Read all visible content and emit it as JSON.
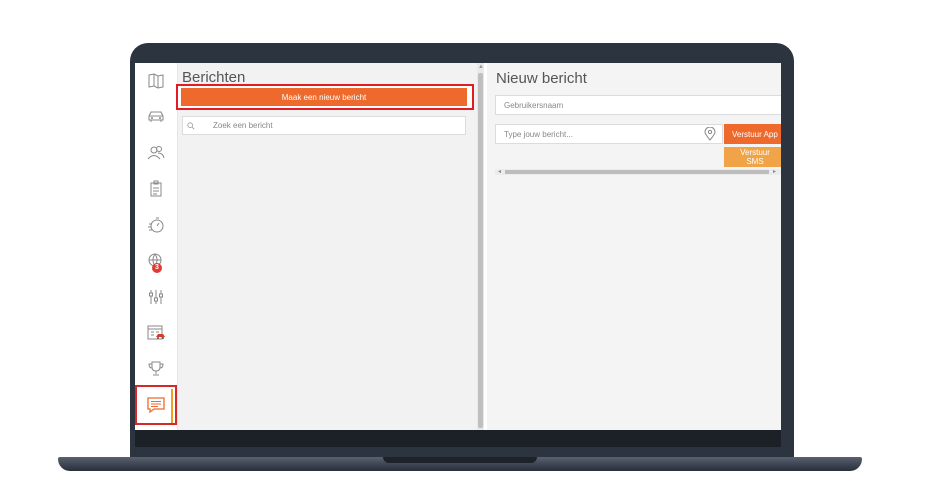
{
  "sidebar": {
    "items": [
      {
        "icon": "map-icon"
      },
      {
        "icon": "car-icon"
      },
      {
        "icon": "users-icon"
      },
      {
        "icon": "clipboard-icon"
      },
      {
        "icon": "stopwatch-icon"
      },
      {
        "icon": "globe-icon",
        "badge": "3"
      },
      {
        "icon": "sliders-icon"
      },
      {
        "icon": "calendar-car-icon"
      },
      {
        "icon": "trophy-icon"
      },
      {
        "icon": "chat-icon",
        "active": true
      }
    ]
  },
  "messages": {
    "title": "Berichten",
    "new_message_label": "Maak een nieuw bericht",
    "search_placeholder": "Zoek een bericht"
  },
  "compose": {
    "title": "Nieuw bericht",
    "recipient_placeholder": "Gebruikersnaam",
    "message_placeholder": "Type jouw bericht...",
    "send_app_label": "Verstuur App",
    "send_sms_label": "Verstuur SMS"
  },
  "colors": {
    "accent": "#ee6a2c",
    "accent_light": "#f0a347",
    "highlight": "#e31b23",
    "badge": "#e53935"
  }
}
